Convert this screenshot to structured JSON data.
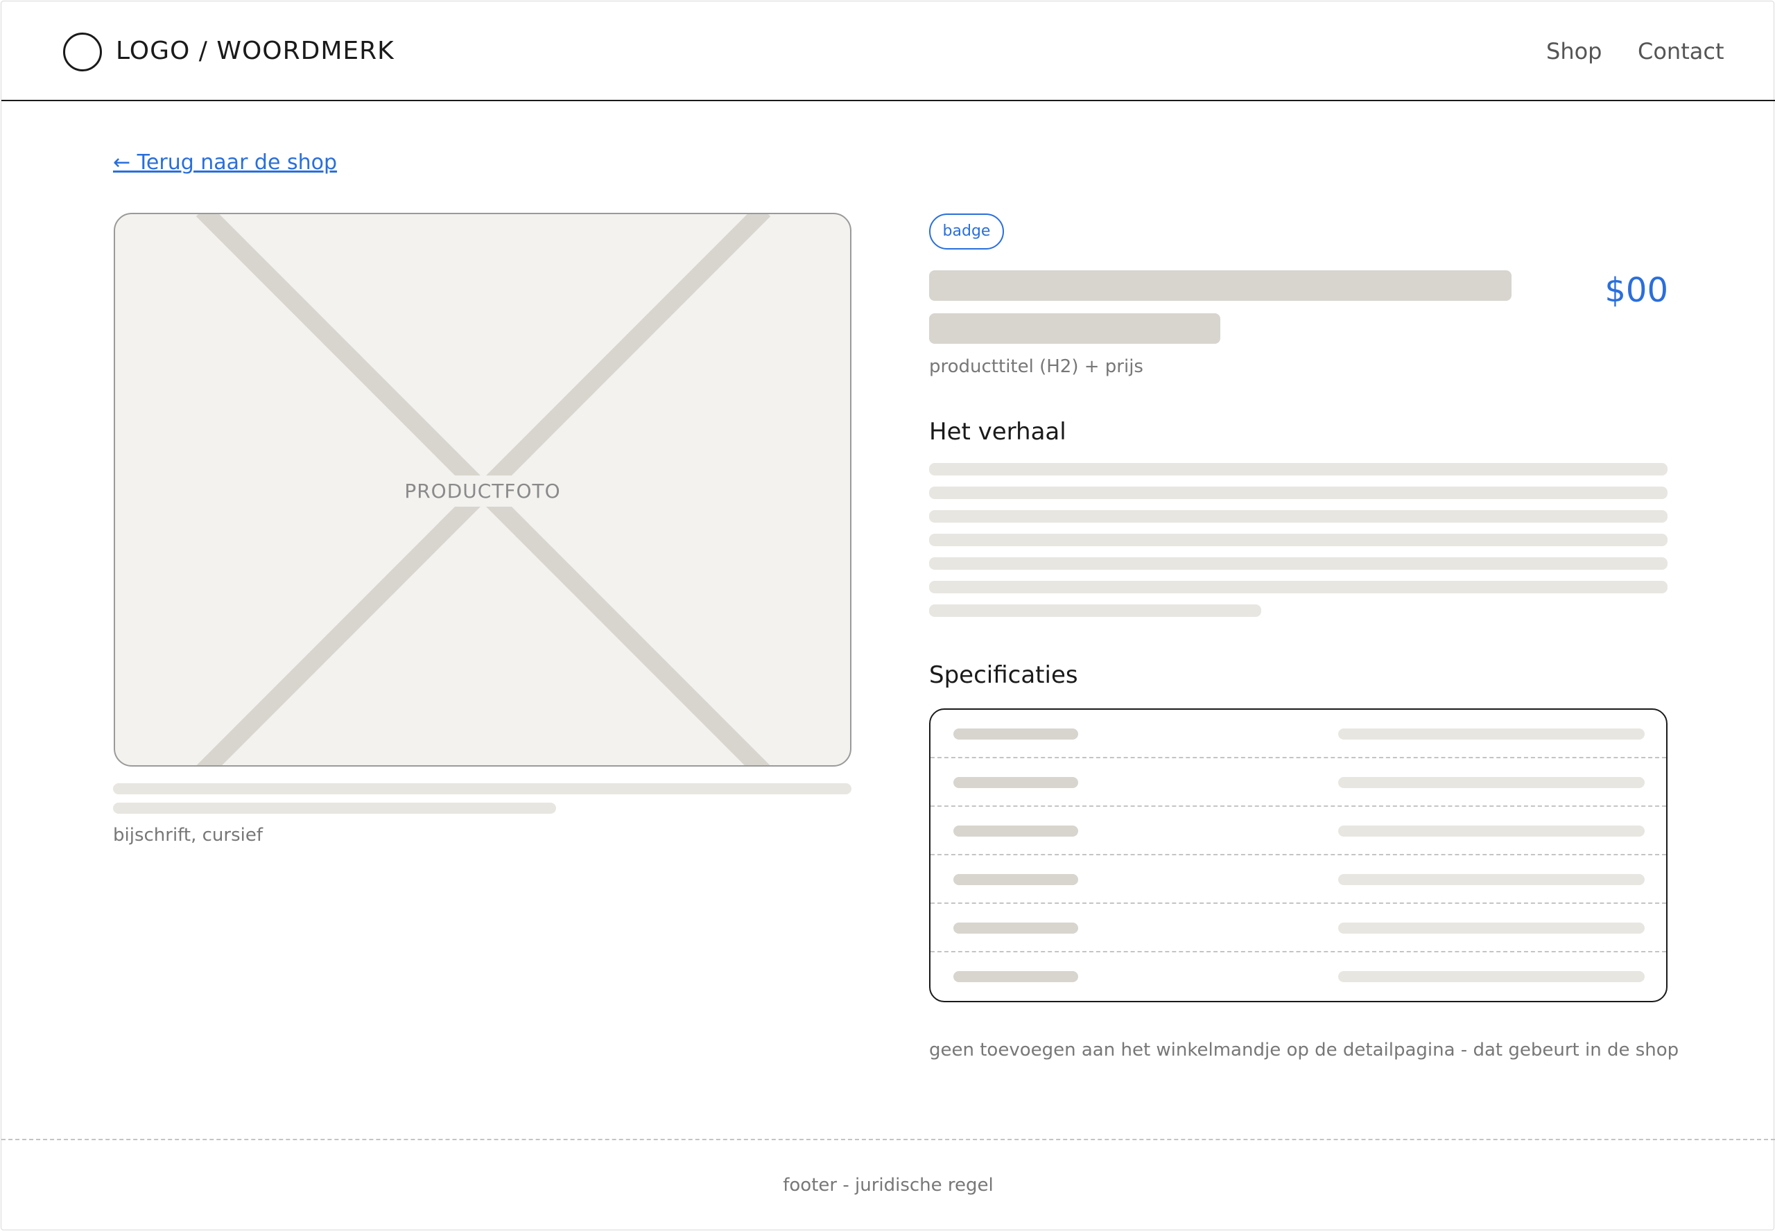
{
  "header": {
    "logo_text": "LOGO / WOORDMERK",
    "nav": [
      {
        "label": "Shop"
      },
      {
        "label": "Contact"
      }
    ]
  },
  "back_link": "← Terug naar de shop",
  "photo": {
    "label": "PRODUCTFOTO",
    "caption_note": "bijschrift, cursief"
  },
  "product": {
    "badge": "badge",
    "price": "$00",
    "title_note": "producttitel (H2) + prijs"
  },
  "story": {
    "heading": "Het verhaal"
  },
  "specs": {
    "heading": "Specificaties",
    "row_count": 6
  },
  "cart_note": "geen toevoegen aan het winkelmandje op de detailpagina - dat gebeurt in de shop",
  "footer": {
    "text": "footer - juridische regel"
  },
  "colors": {
    "accent": "#2a6fdb",
    "placeholder_dark": "#d8d5ce",
    "placeholder_light": "#e8e6e1",
    "photo_bg": "#f3f2ef"
  }
}
